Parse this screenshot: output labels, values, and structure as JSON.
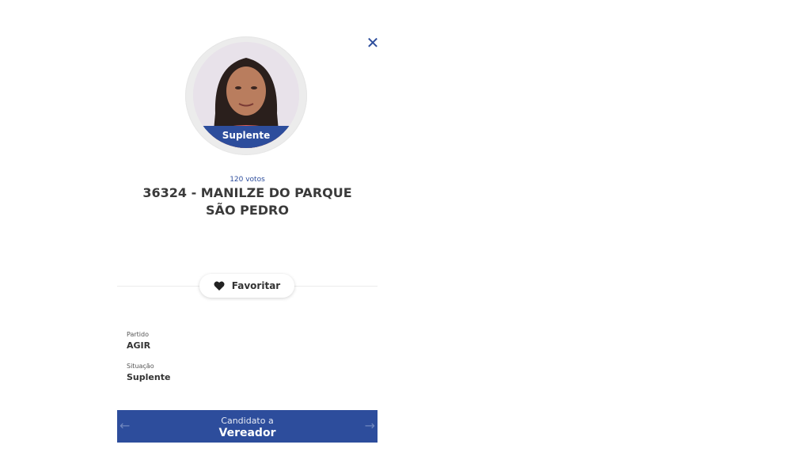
{
  "candidate": {
    "badge": "Suplente",
    "votes": "120 votos",
    "name": "36324 - MANILZE DO PARQUE SÃO PEDRO"
  },
  "actions": {
    "favorite_label": "Favoritar"
  },
  "details": [
    {
      "label": "Partido",
      "value": "AGIR"
    },
    {
      "label": "Situação",
      "value": "Suplente"
    }
  ],
  "footer": {
    "subtitle": "Candidato a",
    "title": "Vereador"
  },
  "icons": {
    "close": "close-icon",
    "heart": "heart-icon",
    "prev": "arrow-left-icon",
    "next": "arrow-right-icon"
  },
  "colors": {
    "accent": "#2d4d9c"
  }
}
